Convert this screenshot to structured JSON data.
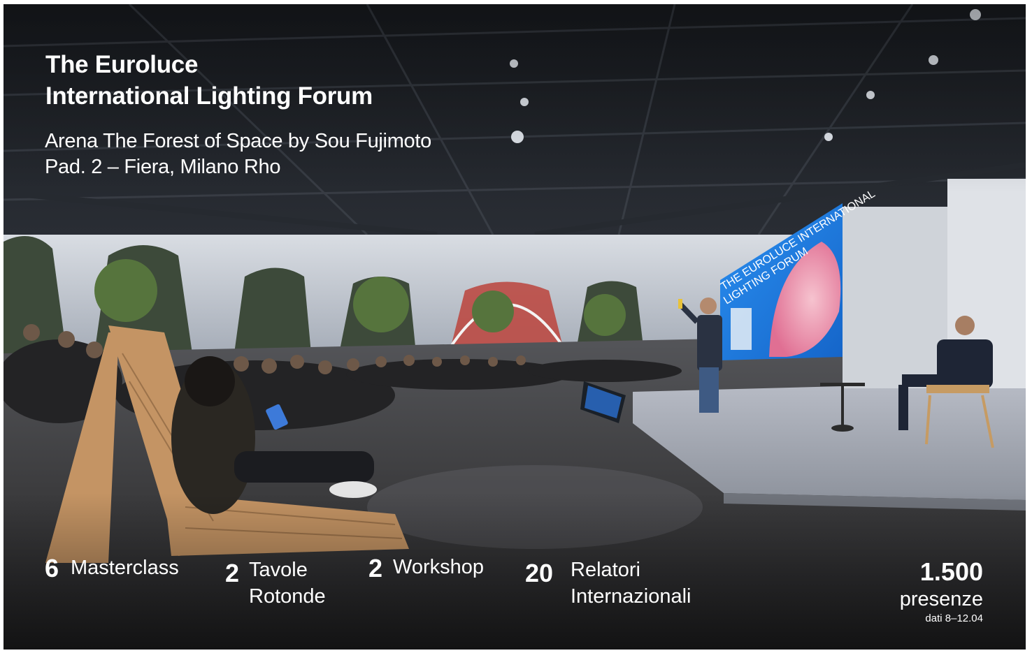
{
  "header": {
    "title_line1": "The Euroluce",
    "title_line2": "International Lighting Forum",
    "location_line1": "Arena The Forest of Space by Sou Fujimoto",
    "location_line2": "Pad. 2 – Fiera, Milano Rho"
  },
  "stats": {
    "masterclass": {
      "number": "6",
      "label": "Masterclass"
    },
    "tavole": {
      "number": "2",
      "label_line1": "Tavole",
      "label_line2": "Rotonde"
    },
    "workshop": {
      "number": "2",
      "label": "Workshop"
    },
    "relatori": {
      "number": "20",
      "label_line1": "Relatori",
      "label_line2": "Internazionali"
    },
    "presenze": {
      "number": "1.500",
      "label": "presenze",
      "note": "dati 8–12.04"
    }
  },
  "screen": {
    "line1": "THE EUROLUCE INTERNATIONAL",
    "line2": "LIGHTING FORUM"
  },
  "colors": {
    "text": "#ffffff",
    "stage_screen": "#1f7fe0",
    "screen_accent": "#e87ba0"
  }
}
